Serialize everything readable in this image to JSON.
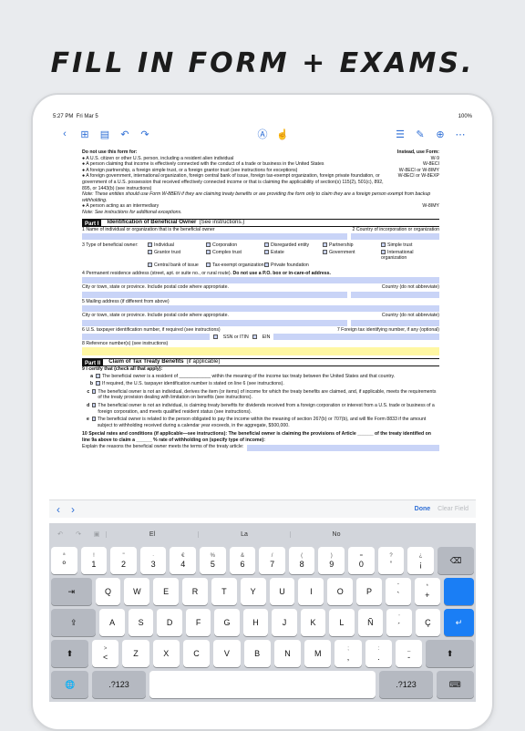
{
  "headline": "FILL IN FORM + EXAMS.",
  "status": {
    "time": "5:27 PM",
    "date": "Fri Mar 5",
    "battery": "100%"
  },
  "toolbar": {
    "back": "‹",
    "grid": "⊞",
    "doc": "▤",
    "undo": "↶",
    "redo": "↷",
    "pen": "Ⓐ",
    "hand": "☝",
    "list": "☰",
    "edit": "✎",
    "add": "⊕",
    "more": "⋯"
  },
  "form": {
    "intro_l": "Do not use this form for:",
    "intro_r": "Instead, use Form:",
    "uses": [
      {
        "t": "● A U.S. citizen or other U.S. person, including a resident alien individual",
        "f": "W-9"
      },
      {
        "t": "● A person claiming that income is effectively connected with the conduct of a trade or business in the United States",
        "f": "W-8ECI"
      },
      {
        "t": "● A foreign partnership, a foreign simple trust, or a foreign grantor trust (see instructions for exceptions)",
        "f": "W-8ECI or W-8IMY"
      },
      {
        "t": "● A foreign government, international organization, foreign central bank of issue, foreign tax-exempt organization, foreign private foundation, or government of a U.S. possession that received effectively connected income or that is claiming the applicability of section(s) 115(2), 501(c), 892, 895, or 1443(b) (see instructions)",
        "f": "W-8ECI or W-8EXP"
      }
    ],
    "note1": "Note: These entities should use Form W-8BEN if they are claiming treaty benefits or are providing the form only to claim they are a foreign person exempt from backup withholding.",
    "inter": "● A person acting as an intermediary",
    "inter_f": "W-8IMY",
    "note2": "Note: See instructions for additional exceptions.",
    "p1_label": "Part I",
    "p1_title": "Identification of Beneficial Owner",
    "p1_sub": "(See instructions.)",
    "l1": "1   Name of individual or organization that is the beneficial owner",
    "l2": "2   Country of incorporation or organization",
    "l3": "3   Type of beneficial owner:",
    "types": [
      "Individual",
      "Corporation",
      "Disregarded entity",
      "Partnership",
      "Simple trust",
      "Grantor trust",
      "Complex trust",
      "Estate",
      "Government",
      "International organization",
      "Central bank of issue",
      "Tax-exempt organization",
      "Private foundation"
    ],
    "l4": "4   Permanent residence address (street, apt. or suite no., or rural route).",
    "l4b": "Do not use a P.O. box or in-care-of address.",
    "city": "City or town, state or province. Include postal code where appropriate.",
    "country": "Country (do not abbreviate)",
    "l5": "5   Mailing address (if different from above)",
    "l6": "6   U.S. taxpayer identification number, if required (see instructions)",
    "l7": "7   Foreign tax identifying number, if any (optional)",
    "ssn": "SSN or ITIN",
    "ein": "EIN",
    "l8": "8   Reference number(s) (see instructions)",
    "p2_label": "Part II",
    "p2_title": "Claim of Tax Treaty Benefits",
    "p2_sub": "(if applicable)",
    "l9": "9   I certify that (check all that apply):",
    "c9": [
      {
        "k": "a",
        "t": "The beneficial owner is a resident of ____________ within the meaning of the income tax treaty between the United States and that country."
      },
      {
        "k": "b",
        "t": "If required, the U.S. taxpayer identification number is stated on line 6 (see instructions)."
      },
      {
        "k": "c",
        "t": "The beneficial owner is not an individual, derives the item (or items) of income for which the treaty benefits are claimed, and, if applicable, meets the requirements of the treaty provision dealing with limitation on benefits (see instructions)."
      },
      {
        "k": "d",
        "t": "The beneficial owner is not an individual, is claiming treaty benefits for dividends received from a foreign corporation or interest from a U.S. trade or business of a foreign corporation, and meets qualified resident status (see instructions)."
      },
      {
        "k": "e",
        "t": "The beneficial owner is related to the person obligated to pay the income within the meaning of section 267(b) or 707(b), and will file Form 8833 if the amount subject to withholding received during a calendar year exceeds, in the aggregate, $500,000."
      }
    ],
    "l10": "10  Special rates and conditions (if applicable—see instructions): The beneficial owner is claiming the provisions of Article ______ of the treaty identified on line 9a above to claim a ______ % rate of withholding on (specify type of income):",
    "l10b": "Explain the reasons the beneficial owner meets the terms of the treaty article:"
  },
  "accbar": {
    "prev": "‹",
    "next": "›",
    "done": "Done",
    "clear": "Clear Field"
  },
  "suggest": [
    "El",
    "La",
    "No"
  ],
  "keys": {
    "r1": [
      [
        "ª",
        "º"
      ],
      [
        "!",
        "1"
      ],
      [
        "\"",
        "2"
      ],
      [
        "·",
        "3"
      ],
      [
        "€",
        "4"
      ],
      [
        "%",
        "5"
      ],
      [
        "&",
        "6"
      ],
      [
        "/",
        "7"
      ],
      [
        "(",
        "8"
      ],
      [
        ")",
        "9"
      ],
      [
        "=",
        "0"
      ],
      [
        "?",
        "'"
      ],
      [
        "¿",
        "¡"
      ]
    ],
    "r2": [
      "Q",
      "W",
      "E",
      "R",
      "T",
      "Y",
      "U",
      "I",
      "O",
      "P"
    ],
    "r2x": [
      [
        "ˆ",
        "`"
      ],
      [
        "*",
        "+"
      ]
    ],
    "r3": [
      "A",
      "S",
      "D",
      "F",
      "G",
      "H",
      "J",
      "K",
      "L",
      "Ñ"
    ],
    "r3x": [
      [
        "¨",
        "´"
      ],
      [
        "",
        "Ç"
      ]
    ],
    "r4": [
      "Z",
      "X",
      "C",
      "V",
      "B",
      "N",
      "M"
    ],
    "r4x": [
      [
        ">",
        "<"
      ],
      [
        ";",
        ","
      ],
      [
        ":",
        "."
      ],
      [
        "_",
        "-"
      ]
    ],
    "num": ".?123",
    "tab": "⇥",
    "caps": "⇪",
    "ret": "↵",
    "shift": "⬆",
    "del": "⌫",
    "globe": "🌐",
    "hide": "⌨"
  }
}
